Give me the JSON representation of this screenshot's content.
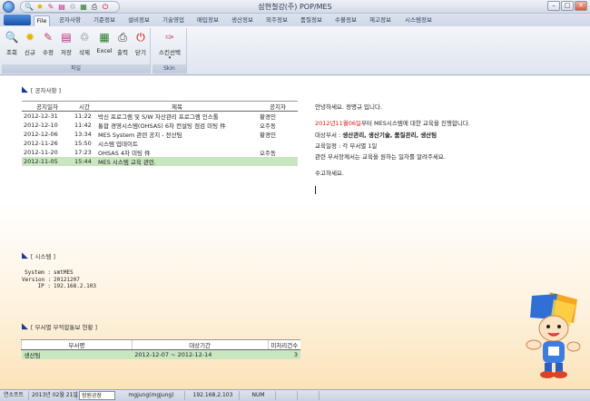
{
  "window": {
    "title": "삼현철강(주) POP/MES"
  },
  "quick_access": {
    "icons": [
      "search-icon",
      "new-icon",
      "edit-icon",
      "save-icon",
      "delete-icon",
      "excel-icon",
      "print-icon",
      "power-icon"
    ]
  },
  "menu_tabs": [
    "File",
    "공자사항",
    "기준정보",
    "설비정보",
    "기술영업",
    "매입정보",
    "생산정보",
    "외주정보",
    "품질정보",
    "수불정보",
    "재고정보",
    "시스템정보"
  ],
  "ribbon": {
    "groups": [
      {
        "label": "파일",
        "buttons": [
          {
            "label": "조회",
            "icon": "search-icon"
          },
          {
            "label": "신규",
            "icon": "new-icon"
          },
          {
            "label": "수정",
            "icon": "edit-icon"
          },
          {
            "label": "저장",
            "icon": "save-icon"
          },
          {
            "label": "삭제",
            "icon": "delete-icon"
          },
          {
            "label": "Excel",
            "icon": "excel-icon"
          },
          {
            "label": "출력",
            "icon": "print-icon"
          },
          {
            "label": "닫기",
            "icon": "power-icon"
          }
        ]
      },
      {
        "label": "Skin",
        "buttons": [
          {
            "label": "스킨선택",
            "icon": "skin-icon"
          }
        ]
      }
    ]
  },
  "notice": {
    "title": "[ 공자사항 ]",
    "columns": [
      "공지일자",
      "시간",
      "제목",
      "공지자"
    ],
    "rows": [
      [
        "2012-12-31",
        "11:22",
        "박신 프로그램 및 S/W 자산관리 프로그램 인스톨",
        "황경인"
      ],
      [
        "2012-12-10",
        "11:42",
        "통합 경영시스템(OHSAS) 6차 컨설팅 점검 미팅 件",
        "오주동"
      ],
      [
        "2012-12-06",
        "13:34",
        "MES System 관련 공지 - 전산팀",
        "황경인"
      ],
      [
        "2012-11-26",
        "15:50",
        "시스템 업데이트",
        ""
      ],
      [
        "2012-11-20",
        "17:23",
        "OHSAS 4차 미팅 件",
        "오주동"
      ],
      [
        "2012-11-05",
        "15:44",
        "MES 시스템 교육 관련.",
        ""
      ]
    ],
    "selected_row": 5
  },
  "message": {
    "greeting": "안녕하세요. 정명규 입니다.",
    "date_highlight": "2012년11월06일",
    "line2_rest": "부터 MES시스템에 대한 교육을 진행합니다.",
    "targets_label": "대상부서 : ",
    "targets": "생산관리, 생산기술, 품질관리, 생산팀",
    "schedule": "교육일정 : 각 부서별 1일",
    "request": "관련 부서장께서는 교육을 원하는 일자를 알려주세요.",
    "closing": "수고하세요."
  },
  "system": {
    "title": "[ 시스템 ]",
    "fields": [
      {
        "key": "System :",
        "value": "smtMES"
      },
      {
        "key": "Version :",
        "value": "20121207"
      },
      {
        "key": "IP :",
        "value": "192.168.2.103"
      }
    ]
  },
  "dept": {
    "title": "[ 부서별 부적합통보 현황 ]",
    "columns": [
      "부서명",
      "대상기간",
      "미처리건수"
    ],
    "rows": [
      [
        "생산팀",
        "2012-12-07 ~ 2012-12-14",
        "3"
      ]
    ]
  },
  "statusbar": {
    "company": "연소프트",
    "date": "2013년 02월 21일",
    "plant": "장원공장",
    "user": "mgjung(mgjung)",
    "ip": "192.168.2.103",
    "num": "NUM"
  }
}
